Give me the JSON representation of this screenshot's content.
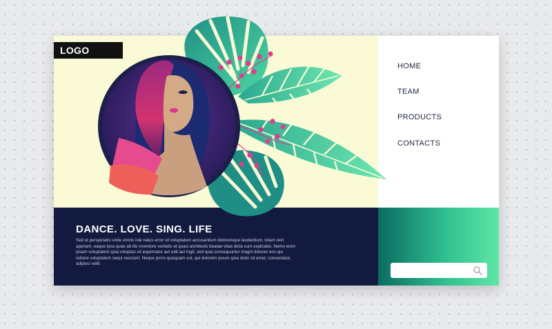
{
  "brand": {
    "logo_text": "LOGO"
  },
  "nav": {
    "items": [
      {
        "label": "HOME"
      },
      {
        "label": "TEAM"
      },
      {
        "label": "PRODUCTS"
      },
      {
        "label": "CONTACTS"
      }
    ]
  },
  "hero": {
    "headline": "DANCE. LOVE. SING. LIFE",
    "body": "Sed ut perspiciatis unde omnis iste natus error sit voluptatem accusantium doloremque laudantium, totam rem aperiam, eaque ipsa quae ab illo inventore veritatis et quasi architecto beatae vitae dicta sunt explicabo. Nemo enim ipsam voluptatem quia voluptas sit aspernatur aut odit aut fugit, sed quia consequuntur magni dolores eos qui ratione voluptatem sequi nesciunt. Neque porro quisquam est, qui dolorem ipsum quia dolor sit amet, consectetur, adipisci veliti"
  },
  "search": {
    "placeholder": "",
    "value": ""
  },
  "colors": {
    "hero_bg": "#fafbd6",
    "panel_dark": "#121b3f",
    "accent_green": "#2fbf8f",
    "leaf_green": "#2fbf8f",
    "berry_pink": "#e23d8c"
  },
  "icons": {
    "search": "search-icon",
    "logo": "logo-mark",
    "illustration": "woman-portrait-illustration"
  }
}
